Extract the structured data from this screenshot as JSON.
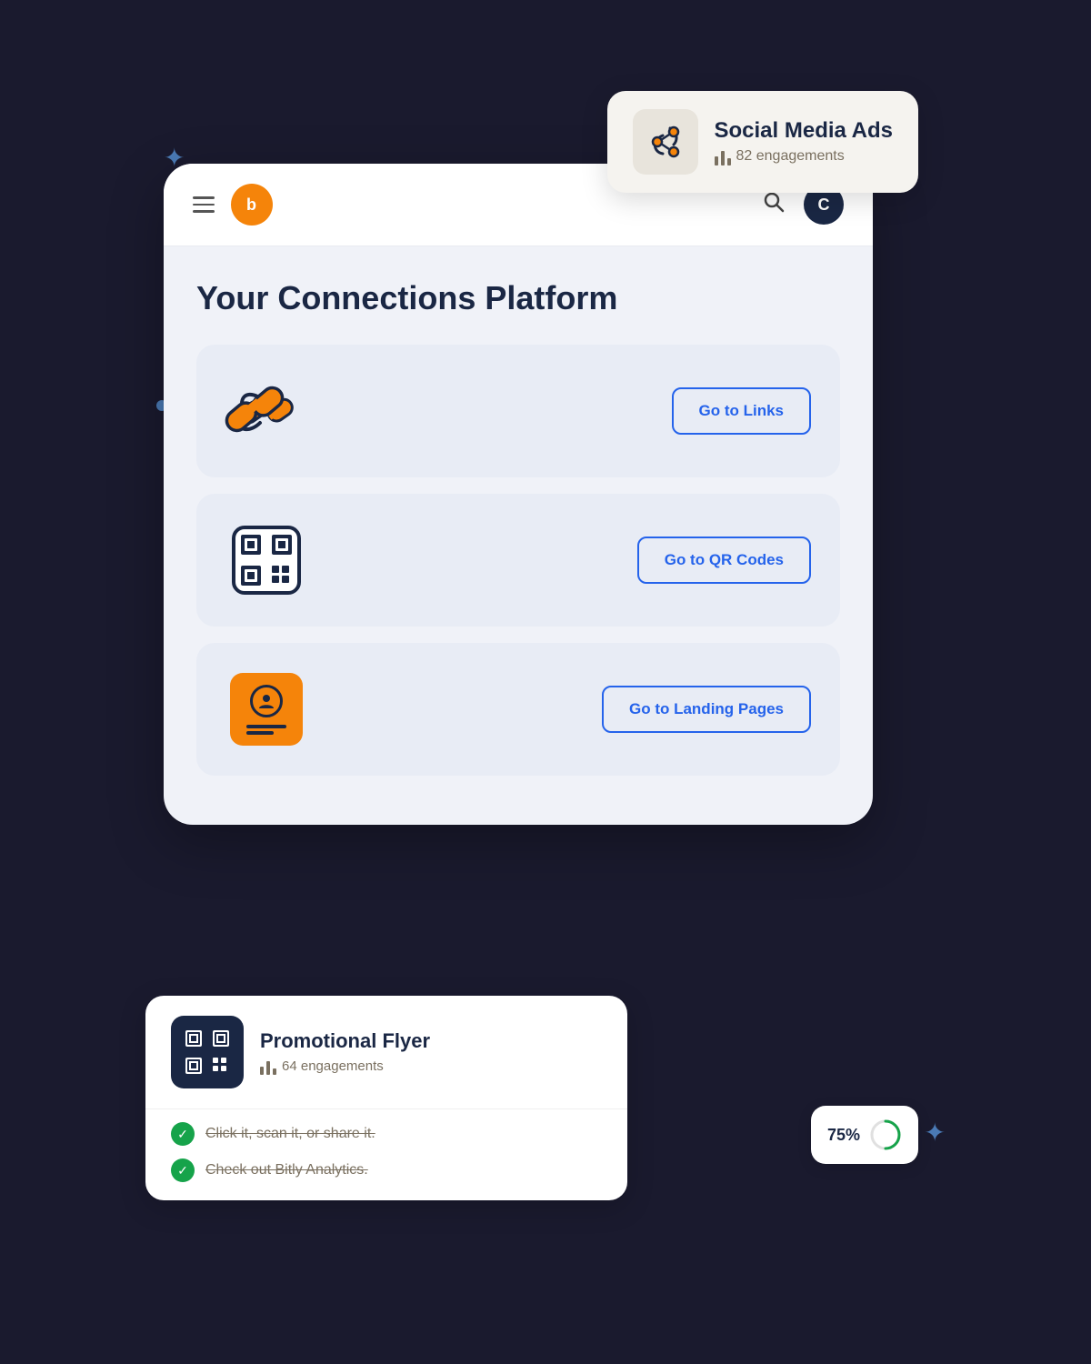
{
  "topCard": {
    "title": "Social Media Ads",
    "engagements": "82 engagements"
  },
  "navbar": {
    "logoLetter": "b",
    "avatarLetter": "C"
  },
  "pageTitle": "Your Connections Platform",
  "featureCards": [
    {
      "id": "links",
      "buttonLabel": "Go to Links"
    },
    {
      "id": "qrcodes",
      "buttonLabel": "Go to QR Codes"
    },
    {
      "id": "landingpages",
      "buttonLabel": "Go to Landing Pages"
    }
  ],
  "bottomCard": {
    "title": "Promotional Flyer",
    "engagements": "64 engagements"
  },
  "progressPercent": "75%",
  "checkItems": [
    {
      "label": "Click it, scan it, or share it."
    },
    {
      "label": "Check out Bitly Analytics."
    }
  ],
  "sparkles": [
    "✦",
    "✦",
    "✦",
    "✦"
  ],
  "colors": {
    "orange": "#f5840a",
    "blue": "#2563eb",
    "dark": "#1a2744",
    "lightBg": "#f0f2f8",
    "cardBg": "#e8ecf5"
  }
}
